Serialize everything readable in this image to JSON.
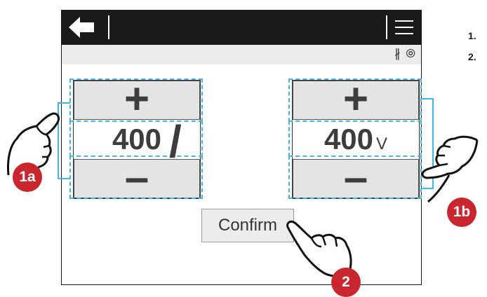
{
  "screen": {
    "left_value": "400",
    "right_value": "400",
    "right_unit": "V",
    "separator": "/",
    "plus_symbol": "+",
    "minus_symbol": "–",
    "confirm_label": "Confirm",
    "titlebar_icons": [
      "back-arrow-icon",
      "menu-icon"
    ],
    "status_icons": [
      "bluetooth-icon",
      "signal-icon"
    ],
    "status_glyphs": {
      "bluetooth": "∦",
      "signal": "⦾"
    }
  },
  "annotations": {
    "badges": [
      "1a",
      "1b",
      "2"
    ],
    "steps": [
      "1.",
      "2."
    ]
  },
  "colors": {
    "highlight": "#43b5e6",
    "badge": "#c9262f",
    "titlebar": "#1a1a1a",
    "button_bg": "#e4e4e4"
  }
}
